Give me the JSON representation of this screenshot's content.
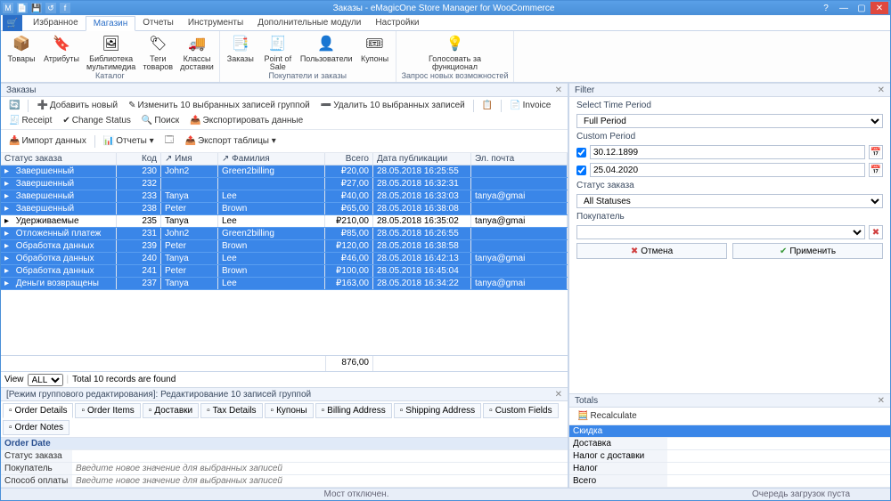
{
  "title": "Заказы - eMagicOne Store Manager for WooCommerce",
  "qat_icons": [
    "M",
    "📄",
    "💾",
    "↺",
    "f"
  ],
  "win": {
    "help": "?",
    "min": "—",
    "max": "▢",
    "close": "✕"
  },
  "ribbon_file_icon": "🛒",
  "ribbon_tabs": [
    "Избранное",
    "Магазин",
    "Отчеты",
    "Инструменты",
    "Дополнительные модули",
    "Настройки"
  ],
  "ribbon_active_tab": 1,
  "ribbon_groups": [
    {
      "label": "Каталог",
      "buttons": [
        {
          "icon": "📦",
          "text": "Товары"
        },
        {
          "icon": "🔖",
          "text": "Атрибуты"
        },
        {
          "icon": "🖼",
          "text": "Библиотека\nмультимедиа"
        },
        {
          "icon": "🏷",
          "text": "Теги\nтоваров"
        },
        {
          "icon": "🚚",
          "text": "Классы\nдоставки"
        }
      ]
    },
    {
      "label": "Покупатели и заказы",
      "buttons": [
        {
          "icon": "📑",
          "text": "Заказы"
        },
        {
          "icon": "🧾",
          "text": "Point of\nSale"
        },
        {
          "icon": "👤",
          "text": "Пользователи"
        },
        {
          "icon": "🎟",
          "text": "Купоны"
        }
      ]
    },
    {
      "label": "Запрос новых возможностей",
      "buttons": [
        {
          "icon": "💡",
          "text": "Голосовать за\nфункционал"
        }
      ]
    }
  ],
  "orders_panel_title": "Заказы",
  "orders_toolbar": [
    {
      "icon": "🔄",
      "text": ""
    },
    {
      "icon": "➕",
      "text": "Добавить новый"
    },
    {
      "icon": "✎",
      "text": "Изменить 10 выбранных записей группой"
    },
    {
      "icon": "➖",
      "text": "Удалить 10 выбранных записей"
    },
    {
      "icon": "📋",
      "text": ""
    },
    {
      "icon": "📄",
      "text": "Invoice"
    },
    {
      "icon": "🧾",
      "text": "Receipt"
    },
    {
      "icon": "✔",
      "text": "Change Status"
    },
    {
      "icon": "🔍",
      "text": "Поиск"
    },
    {
      "icon": "📤",
      "text": "Экспортировать данные"
    }
  ],
  "orders_toolbar2": [
    {
      "icon": "📥",
      "text": "Импорт данных"
    },
    {
      "icon": "📊",
      "text": "Отчеты ▾"
    },
    {
      "icon": "🗔",
      "text": ""
    },
    {
      "icon": "📤",
      "text": "Экспорт таблицы ▾"
    }
  ],
  "grid_cols": [
    "Статус заказа",
    "Код",
    "↗ Имя",
    "↗ Фамилия",
    "Всего",
    "Дата публикации",
    "Эл. почта"
  ],
  "grid_rows": [
    {
      "status": "Завершенный",
      "code": "230",
      "name": "John2",
      "surname": "Green2billing",
      "total": "₽20,00",
      "date": "28.05.2018 16:25:55",
      "email": ""
    },
    {
      "status": "Завершенный",
      "code": "232",
      "name": "",
      "surname": "",
      "total": "₽27,00",
      "date": "28.05.2018 16:32:31",
      "email": ""
    },
    {
      "status": "Завершенный",
      "code": "233",
      "name": "Tanya",
      "surname": "Lee",
      "total": "₽40,00",
      "date": "28.05.2018 16:33:03",
      "email": "tanya@gmai"
    },
    {
      "status": "Завершенный",
      "code": "238",
      "name": "Peter",
      "surname": "Brown",
      "total": "₽65,00",
      "date": "28.05.2018 16:38:08",
      "email": ""
    },
    {
      "status": "Удерживаемые",
      "code": "235",
      "name": "Tanya",
      "surname": "Lee",
      "total": "₽210,00",
      "date": "28.05.2018 16:35:02",
      "email": "tanya@gmai",
      "held": true
    },
    {
      "status": "Отложенный платеж",
      "code": "231",
      "name": "John2",
      "surname": "Green2billing",
      "total": "₽85,00",
      "date": "28.05.2018 16:26:55",
      "email": ""
    },
    {
      "status": "Обработка данных",
      "code": "239",
      "name": "Peter",
      "surname": "Brown",
      "total": "₽120,00",
      "date": "28.05.2018 16:38:58",
      "email": ""
    },
    {
      "status": "Обработка данных",
      "code": "240",
      "name": "Tanya",
      "surname": "Lee",
      "total": "₽46,00",
      "date": "28.05.2018 16:42:13",
      "email": "tanya@gmai"
    },
    {
      "status": "Обработка данных",
      "code": "241",
      "name": "Peter",
      "surname": "Brown",
      "total": "₽100,00",
      "date": "28.05.2018 16:45:04",
      "email": ""
    },
    {
      "status": "Деньги возвращены",
      "code": "237",
      "name": "Tanya",
      "surname": "Lee",
      "total": "₽163,00",
      "date": "28.05.2018 16:34:22",
      "email": "tanya@gmai"
    }
  ],
  "grid_sum": "876,00",
  "viewbar": {
    "view": "View",
    "all": "ALL",
    "records": "Total 10 records are found"
  },
  "bulk_panel_title": "[Режим группового редактирования]: Редактирование 10 записей группой",
  "detail_tabs": [
    "Order Details",
    "Order Items",
    "Доставки",
    "Tax Details",
    "Купоны",
    "Billing Address",
    "Shipping Address",
    "Custom Fields",
    "Order Notes"
  ],
  "prop_hdr": "Order Date",
  "prop_rows": [
    "Статус заказа",
    "Покупатель",
    "Способ оплаты"
  ],
  "prop_placeholder": "Введите новое значение для выбранных записей",
  "filter_title": "Filter",
  "filter": {
    "period_lbl": "Select Time Period",
    "period_val": "Full Period",
    "custom_lbl": "Custom Period",
    "date_from": "30.12.1899",
    "date_to": "25.04.2020",
    "status_lbl": "Статус заказа",
    "status_val": "All Statuses",
    "buyer_lbl": "Покупатель",
    "cancel": "Отмена",
    "apply": "Применить"
  },
  "totals_title": "Totals",
  "recalc": "Recalculate",
  "totals_rows": [
    "Скидка",
    "Доставка",
    "Налог с доставки",
    "Налог",
    "Всего"
  ],
  "status_center": "Мост отключен.",
  "status_right": "Очередь загрузок пуста"
}
